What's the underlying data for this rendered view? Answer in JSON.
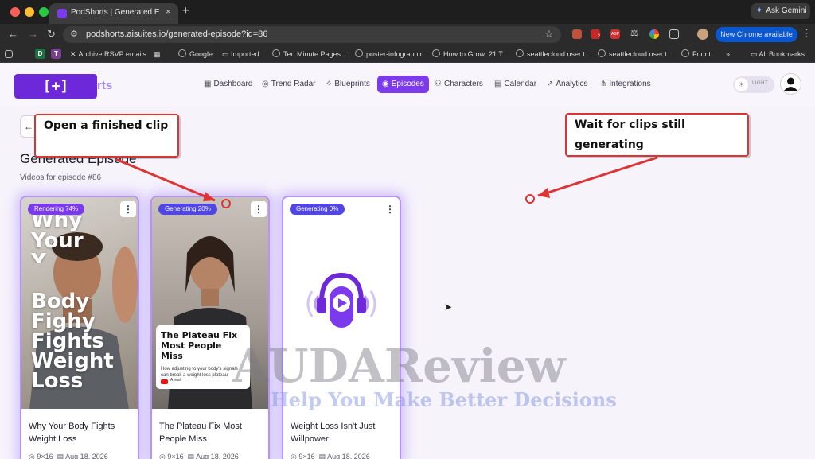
{
  "browser": {
    "tab_title": "PodShorts | Generated Episode",
    "tab_close": "×",
    "new_tab": "+",
    "gemini_label": "Ask Gemini",
    "url": "podshorts.aisuites.io/generated-episode?id=86",
    "new_chrome_label": "New Chrome available",
    "ext_badge": "2",
    "ext_asp": "ASP"
  },
  "bookmarks": {
    "items": [
      {
        "label": "D"
      },
      {
        "label": "T"
      },
      {
        "label": "Archive RSVP emails"
      },
      {
        "label": "Google"
      },
      {
        "label": "Imported"
      },
      {
        "label": "Ten Minute Pages:..."
      },
      {
        "label": "poster-infographic"
      },
      {
        "label": "How to Grow: 21 T..."
      },
      {
        "label": "seattlecloud user t..."
      },
      {
        "label": "seattlecloud user t..."
      },
      {
        "label": "Fount"
      },
      {
        "label": "All Bookmarks"
      }
    ],
    "more": "»"
  },
  "app": {
    "logo_text": "[+]",
    "logo_tail": "rts",
    "nav": [
      {
        "label": "Dashboard",
        "icon": "grid-icon"
      },
      {
        "label": "Trend Radar",
        "icon": "radar-icon"
      },
      {
        "label": "Blueprints",
        "icon": "sparkle-icon"
      },
      {
        "label": "Episodes",
        "icon": "podcast-icon"
      },
      {
        "label": "Characters",
        "icon": "users-icon"
      },
      {
        "label": "Calendar",
        "icon": "calendar-icon"
      },
      {
        "label": "Analytics",
        "icon": "chart-icon"
      },
      {
        "label": "Integrations",
        "icon": "share-icon"
      }
    ],
    "active_nav": "Episodes",
    "theme_label": "LIGHT",
    "accent": "#7c3aed"
  },
  "main": {
    "title": "Generated Episode",
    "subtitle": "Videos for episode #86"
  },
  "cards": [
    {
      "status": "Rendering 74%",
      "progress": 74,
      "title": "Why Your Body Fights Weight Loss",
      "aspect": "9×16",
      "date": "Aug 18, 2026",
      "overlay_lines": [
        "Why",
        "Your",
        "Y",
        "Body",
        "Fighy",
        "Fights",
        "Weight",
        "Loss"
      ]
    },
    {
      "status": "Generating 20%",
      "progress": 20,
      "title": "The Plateau Fix Most People Miss",
      "aspect": "9×16",
      "date": "Aug 18, 2026",
      "overlay_title": "The Plateau Fix Most People Miss",
      "overlay_body": "How adjusting to your body's signals can break a weight loss plateau",
      "overlay_footer": "A real"
    },
    {
      "status": "Generating 0%",
      "progress": 0,
      "title": "Weight Loss Isn't Just Willpower",
      "aspect": "9×16",
      "date": "Aug 18, 2026"
    }
  ],
  "annotations": {
    "left": "Open a finished clip",
    "right": "Wait for clips still generating"
  },
  "watermark": {
    "line1": "AUDAReview",
    "line2": "Help You Make Better Decisions"
  }
}
